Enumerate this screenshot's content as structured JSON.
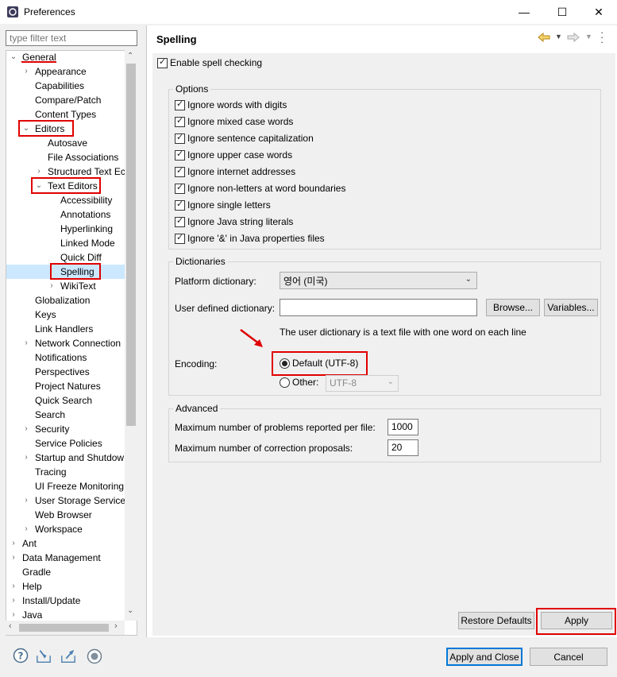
{
  "window": {
    "title": "Preferences",
    "minimize": "—",
    "maximize": "☐",
    "close": "✕"
  },
  "filter": {
    "placeholder": "type filter text"
  },
  "tree": {
    "items": [
      {
        "label": "General"
      },
      {
        "label": "Appearance"
      },
      {
        "label": "Capabilities"
      },
      {
        "label": "Compare/Patch"
      },
      {
        "label": "Content Types"
      },
      {
        "label": "Editors"
      },
      {
        "label": "Autosave"
      },
      {
        "label": "File Associations"
      },
      {
        "label": "Structured Text Ec"
      },
      {
        "label": "Text Editors"
      },
      {
        "label": "Accessibility"
      },
      {
        "label": "Annotations"
      },
      {
        "label": "Hyperlinking"
      },
      {
        "label": "Linked Mode"
      },
      {
        "label": "Quick Diff"
      },
      {
        "label": "Spelling"
      },
      {
        "label": "WikiText"
      },
      {
        "label": "Globalization"
      },
      {
        "label": "Keys"
      },
      {
        "label": "Link Handlers"
      },
      {
        "label": "Network Connection"
      },
      {
        "label": "Notifications"
      },
      {
        "label": "Perspectives"
      },
      {
        "label": "Project Natures"
      },
      {
        "label": "Quick Search"
      },
      {
        "label": "Search"
      },
      {
        "label": "Security"
      },
      {
        "label": "Service Policies"
      },
      {
        "label": "Startup and Shutdow"
      },
      {
        "label": "Tracing"
      },
      {
        "label": "UI Freeze Monitoring"
      },
      {
        "label": "User Storage Service"
      },
      {
        "label": "Web Browser"
      },
      {
        "label": "Workspace"
      },
      {
        "label": "Ant"
      },
      {
        "label": "Data Management"
      },
      {
        "label": "Gradle"
      },
      {
        "label": "Help"
      },
      {
        "label": "Install/Update"
      },
      {
        "label": "Java"
      }
    ]
  },
  "page": {
    "title": "Spelling",
    "enable_spell": "Enable spell checking",
    "options": {
      "legend": "Options",
      "items": [
        "Ignore words with digits",
        "Ignore mixed case words",
        "Ignore sentence capitalization",
        "Ignore upper case words",
        "Ignore internet addresses",
        "Ignore non-letters at word boundaries",
        "Ignore single letters",
        "Ignore Java string literals",
        "Ignore '&' in Java properties files"
      ]
    },
    "dictionaries": {
      "legend": "Dictionaries",
      "platform_label": "Platform dictionary:",
      "platform_value": "영어 (미국)",
      "user_label": "User defined dictionary:",
      "user_value": "",
      "browse": "Browse...",
      "variables": "Variables...",
      "hint": "The user dictionary is a text file with one word on each line",
      "encoding_label": "Encoding:",
      "default_enc": "Default (UTF-8)",
      "other_enc": "Other:",
      "other_value": "UTF-8"
    },
    "advanced": {
      "legend": "Advanced",
      "max_problems_label": "Maximum number of problems reported per file:",
      "max_problems_value": "1000",
      "max_corrections_label": "Maximum number of correction proposals:",
      "max_corrections_value": "20"
    },
    "restore_defaults": "Restore Defaults",
    "apply": "Apply"
  },
  "footer": {
    "apply_close": "Apply and Close",
    "cancel": "Cancel"
  },
  "colors": {
    "highlight": "#e00000",
    "selection": "#cce8ff"
  },
  "icons": [
    "help-icon",
    "import-icon",
    "export-icon",
    "record-icon",
    "back-arrow-icon",
    "forward-arrow-icon",
    "view-menu-icon"
  ]
}
